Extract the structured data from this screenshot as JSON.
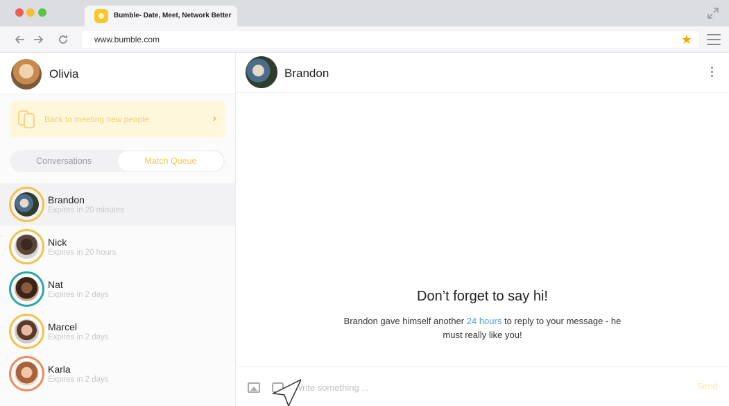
{
  "browser": {
    "tab_title": "Bumble- Date, Meet, Network Better",
    "url": "www.bumble.com"
  },
  "profile": {
    "name": "Olivia"
  },
  "back_card": {
    "label": "Back to meeting new people"
  },
  "segments": {
    "conversations": "Conversations",
    "match_queue": "Match Queue"
  },
  "matches": [
    {
      "name": "Brandon",
      "expires": "Expires in 20 minutes",
      "ring": "#f2c24a"
    },
    {
      "name": "Nick",
      "expires": "Expires in 20 hours",
      "ring": "#f2c24a"
    },
    {
      "name": "Nat",
      "expires": "Expires in 2 days",
      "ring": "#2aa6a6"
    },
    {
      "name": "Marcel",
      "expires": "Expires in 2 days",
      "ring": "#f2c24a"
    },
    {
      "name": "Karla",
      "expires": "Expires in 2 days",
      "ring": "#ee8a5a"
    }
  ],
  "chat": {
    "name": "Brandon",
    "hint_title": "Don’t forget to say hi!",
    "hint_pre": "Brandon gave himself another",
    "hint_link": "24 hours",
    "hint_post": "to reply to your message - he must really like you!",
    "placeholder": "Write something ...",
    "send": "Send"
  },
  "colors": {
    "accent": "#f2c24a",
    "link": "#4aa3d8"
  }
}
